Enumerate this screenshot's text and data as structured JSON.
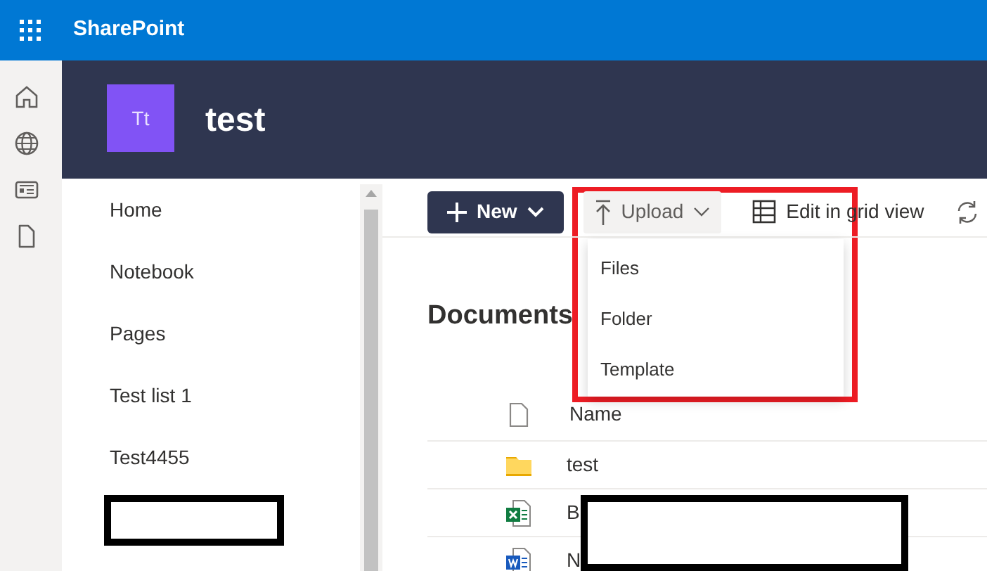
{
  "app_bar": {
    "title": "SharePoint"
  },
  "rail": [
    {
      "kind": "home"
    },
    {
      "kind": "globe"
    },
    {
      "kind": "news"
    },
    {
      "kind": "file"
    }
  ],
  "site": {
    "logo": "Tt",
    "title": "test"
  },
  "nav": {
    "items": [
      "Home",
      "Notebook",
      "Pages",
      "Test list 1",
      "Test4455"
    ]
  },
  "toolbar": {
    "buttons": [
      {
        "label": "New",
        "kind": "primary",
        "expanded": false
      },
      {
        "label": "Upload",
        "kind": "upload",
        "expanded": true
      },
      {
        "label": "Edit in grid view",
        "kind": "grid",
        "expanded": false
      }
    ]
  },
  "upload_menu": {
    "items": [
      "Files",
      "Folder",
      "Template"
    ]
  },
  "library": {
    "title": "Documents",
    "columns": [
      "Name"
    ],
    "rows": [
      {
        "kind": "folder",
        "name": "test"
      },
      {
        "kind": "excel",
        "name": "B"
      },
      {
        "kind": "word",
        "name": "N"
      }
    ]
  }
}
